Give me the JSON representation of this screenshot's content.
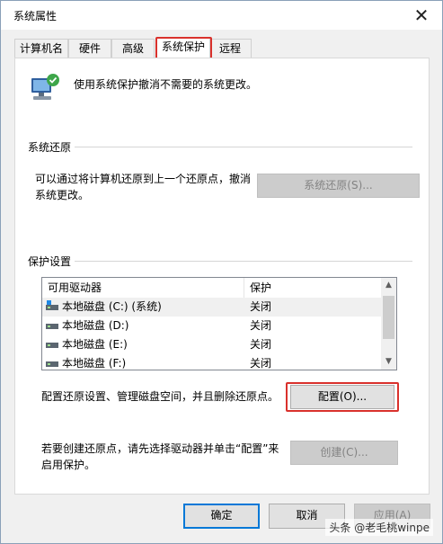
{
  "window": {
    "title": "系统属性",
    "close_glyph": "✕"
  },
  "tabs": [
    {
      "label": "计算机名",
      "active": false
    },
    {
      "label": "硬件",
      "active": false
    },
    {
      "label": "高级",
      "active": false
    },
    {
      "label": "系统保护",
      "active": true
    },
    {
      "label": "远程",
      "active": false
    }
  ],
  "header": {
    "text": "使用系统保护撤消不需要的系统更改。",
    "icon": "system-protection-icon"
  },
  "restore": {
    "group_label": "系统还原",
    "description_line1": "可以通过将计算机还原到上一个还原点，撤消",
    "description_line2": "系统更改。",
    "button_label": "系统还原(S)..."
  },
  "protection": {
    "group_label": "保护设置",
    "columns": [
      "可用驱动器",
      "保护"
    ],
    "drives": [
      {
        "name": "本地磁盘 (C:) (系统)",
        "protection": "关闭",
        "icon": "system-drive-icon"
      },
      {
        "name": "本地磁盘 (D:)",
        "protection": "关闭",
        "icon": "drive-icon"
      },
      {
        "name": "本地磁盘 (E:)",
        "protection": "关闭",
        "icon": "drive-icon"
      },
      {
        "name": "本地磁盘 (F:)",
        "protection": "关闭",
        "icon": "drive-icon"
      }
    ],
    "configure_text": "配置还原设置、管理磁盘空间，并且删除还原点。",
    "configure_button": "配置(O)...",
    "create_text_line1": "若要创建还原点，请先选择驱动器并单击“配置”来",
    "create_text_line2": "启用保护。",
    "create_button": "创建(C)..."
  },
  "footer": {
    "ok": "确定",
    "cancel": "取消",
    "apply": "应用(A)"
  },
  "watermark": "头条 @老毛桃winpe",
  "colors": {
    "highlight_red": "#d9312c",
    "accent_blue": "#0078d7"
  }
}
